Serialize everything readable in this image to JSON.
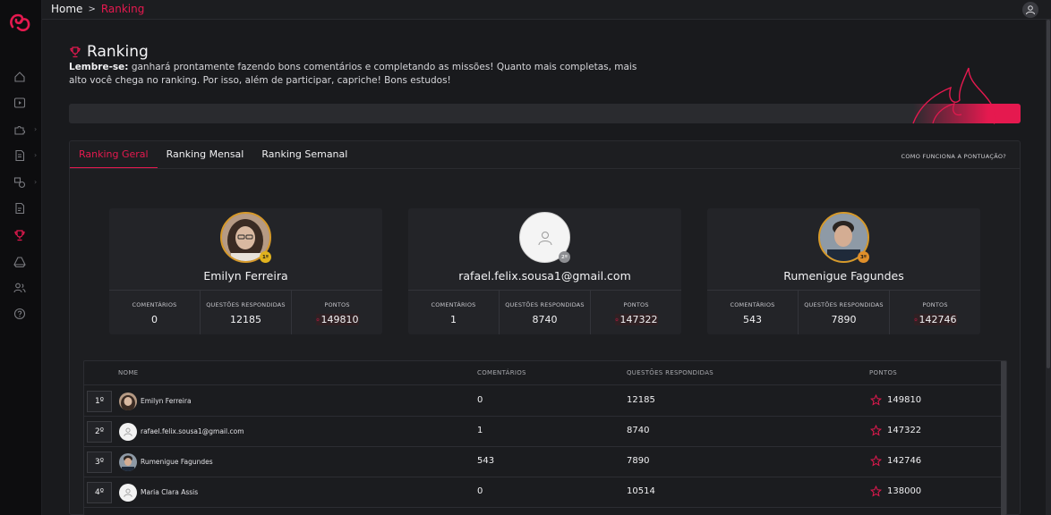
{
  "breadcrumb": {
    "home": "Home",
    "separator": ">",
    "current": "Ranking"
  },
  "header": {
    "title": "Ranking",
    "intro_bold": "Lembre-se:",
    "intro_text": " ganhará prontamente fazendo bons comentários e completando as missões! Quanto mais completas, mais alto você chega no ranking. Por isso, além de participar, capriche! Bons estudos!"
  },
  "sidebar": {
    "items": [
      "home-icon",
      "video-icon",
      "puzzle-icon",
      "document-icon",
      "exchange-icon",
      "notes-icon",
      "trophy-icon",
      "google-drive-icon",
      "users-icon",
      "help-icon"
    ]
  },
  "tabs": [
    {
      "label": "Ranking Geral"
    },
    {
      "label": "Ranking Mensal"
    },
    {
      "label": "Ranking Semanal"
    }
  ],
  "help_link": "COMO FUNCIONA A PONTUAÇÃO?",
  "stat_labels": {
    "comments": "COMENTÁRIOS",
    "questions": "QUESTÕES RESPONDIDAS",
    "points": "PONTOS"
  },
  "podium": [
    {
      "name": "Emilyn Ferreira",
      "medal": "1º",
      "comments": "0",
      "questions": "12185",
      "points": "149810"
    },
    {
      "name": "rafael.felix.sousa1@gmail.com",
      "medal": "2º",
      "comments": "1",
      "questions": "8740",
      "points": "147322"
    },
    {
      "name": "Rumenigue Fagundes",
      "medal": "3º",
      "comments": "543",
      "questions": "7890",
      "points": "142746"
    }
  ],
  "table": {
    "headers": {
      "name": "NOME",
      "comments": "COMENTÁRIOS",
      "questions": "QUESTÕES RESPONDIDAS",
      "points": "PONTOS"
    },
    "rows": [
      {
        "pos": "1º",
        "name": "Emilyn Ferreira",
        "comments": "0",
        "questions": "12185",
        "points": "149810"
      },
      {
        "pos": "2º",
        "name": "rafael.felix.sousa1@gmail.com",
        "comments": "1",
        "questions": "8740",
        "points": "147322"
      },
      {
        "pos": "3º",
        "name": "Rumenigue Fagundes",
        "comments": "543",
        "questions": "7890",
        "points": "142746"
      },
      {
        "pos": "4º",
        "name": "Maria Clara Assis",
        "comments": "0",
        "questions": "10514",
        "points": "138000"
      }
    ]
  },
  "colors": {
    "accent": "#e5194f",
    "background": "#191a1d",
    "sidebar": "#0d0d0f",
    "gold": "#e0b21e"
  }
}
